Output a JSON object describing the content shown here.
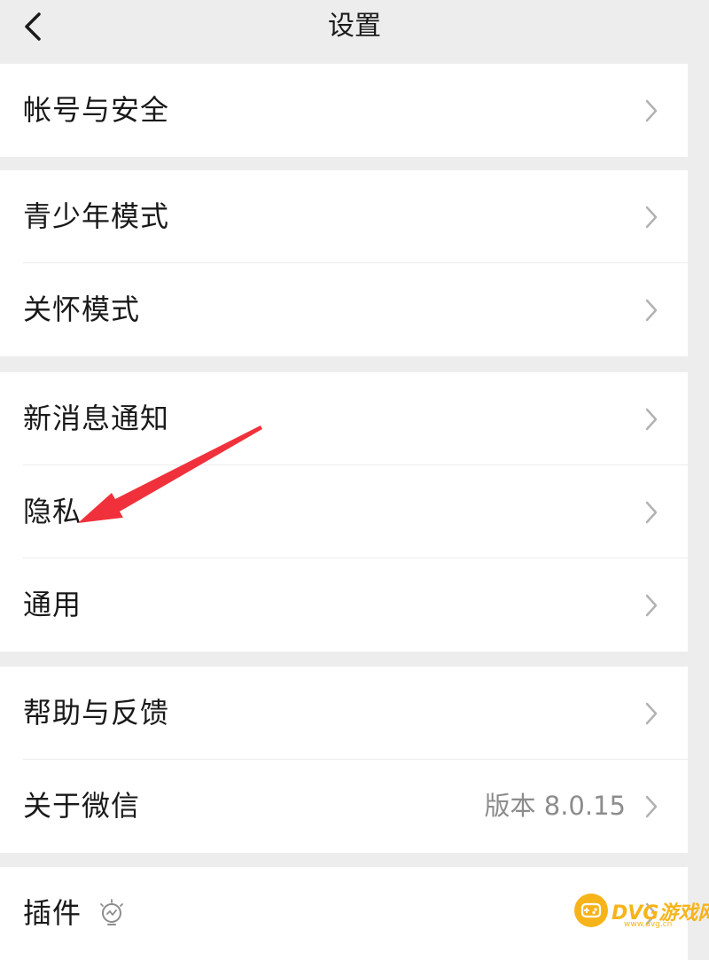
{
  "header": {
    "title": "设置",
    "back_icon": "chevron-left-icon"
  },
  "groups": [
    {
      "items": [
        {
          "label": "帐号与安全"
        }
      ]
    },
    {
      "items": [
        {
          "label": "青少年模式"
        },
        {
          "label": "关怀模式"
        }
      ]
    },
    {
      "items": [
        {
          "label": "新消息通知"
        },
        {
          "label": "隐私"
        },
        {
          "label": "通用"
        }
      ]
    },
    {
      "items": [
        {
          "label": "帮助与反馈"
        },
        {
          "label": "关于微信",
          "value": "版本 8.0.15"
        }
      ]
    },
    {
      "items": [
        {
          "label": "插件",
          "icon": "lightbulb-icon"
        }
      ]
    }
  ],
  "annotation": {
    "arrow_color": "#f0313b",
    "target": "隐私"
  },
  "watermark": {
    "text": "DVG游戏网",
    "sub": "www.dvg.cn",
    "color": "#f6b41a"
  }
}
